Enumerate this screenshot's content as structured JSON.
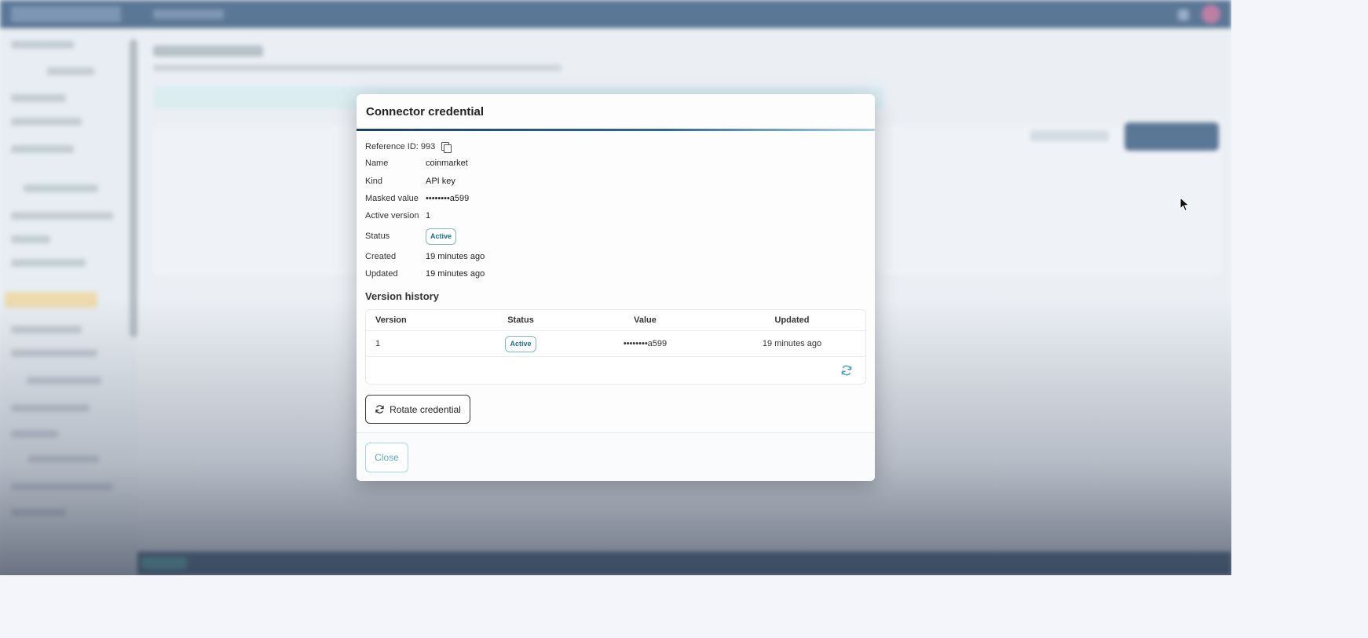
{
  "modal": {
    "title": "Connector credential",
    "reference_label": "Reference ID: 993",
    "fields": [
      {
        "key": "Name",
        "value": "coinmarket"
      },
      {
        "key": "Kind",
        "value": "API key"
      },
      {
        "key": "Masked value",
        "value": "••••••••a599"
      },
      {
        "key": "Active version",
        "value": "1"
      },
      {
        "key": "Status",
        "value": "Active"
      },
      {
        "key": "Created",
        "value": "19 minutes ago"
      },
      {
        "key": "Updated",
        "value": "19 minutes ago"
      }
    ],
    "version_history": {
      "title": "Version history",
      "columns": [
        "Version",
        "Status",
        "Value",
        "Updated"
      ],
      "rows": [
        {
          "version": "1",
          "status": "Active",
          "value": "••••••••a599",
          "updated": "19 minutes ago"
        }
      ]
    },
    "rotate_label": "Rotate credential",
    "close_label": "Close"
  },
  "icons": {
    "copy": "copy-icon",
    "refresh": "refresh-icon",
    "rotate": "rotate-icon",
    "cursor": "mouse-pointer-icon"
  },
  "colors": {
    "topbar": "#123a66",
    "status_badge": "#1c6f8a",
    "close_button_text": "#5fa9c8",
    "accent_rule": "#1b3f6a"
  }
}
